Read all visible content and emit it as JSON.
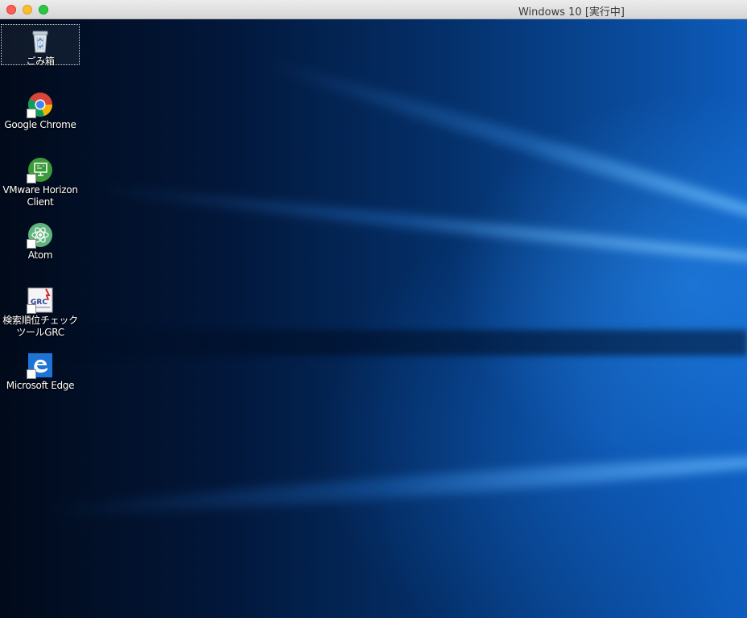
{
  "window": {
    "title": "Windows 10 [実行中]"
  },
  "desktop": {
    "icons": [
      {
        "label": "ごみ箱",
        "icon": "recycle-bin-icon"
      },
      {
        "label": "Google Chrome",
        "icon": "chrome-icon"
      },
      {
        "label": "VMware Horizon Client",
        "icon": "vmware-horizon-icon"
      },
      {
        "label": "Atom",
        "icon": "atom-icon"
      },
      {
        "label": "検索順位チェックツールGRC",
        "icon": "grc-icon"
      },
      {
        "label": "Microsoft Edge",
        "icon": "edge-icon"
      }
    ]
  },
  "colors": {
    "close": "#fc5f57",
    "minimize": "#fdbc2e",
    "maximize": "#28c840",
    "wallpaper_accent": "#0d5cbc"
  }
}
